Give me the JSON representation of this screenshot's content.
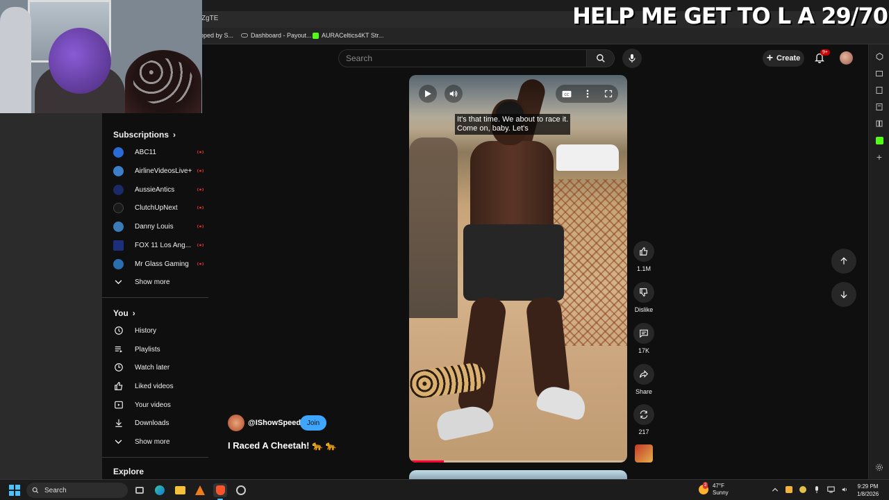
{
  "browser": {
    "url_fragment": "ZgTE",
    "bookmarks": [
      {
        "label": "pped by S...",
        "icon": "bookmark-icon"
      },
      {
        "label": "Dashboard - Payout...",
        "icon": "link-icon"
      },
      {
        "label": "AURACeltics4KT Str...",
        "icon": "kick-icon"
      }
    ]
  },
  "overlay": {
    "banner": "HELP ME GET TO L A 29/70"
  },
  "header": {
    "search_placeholder": "Search",
    "create_label": "Create",
    "notif_count": "9+"
  },
  "guide": {
    "subscriptions_title": "Subscriptions",
    "subscriptions": [
      {
        "label": "ABC11",
        "color": "#2b6bd6"
      },
      {
        "label": "AirlineVideosLive+",
        "color": "#3d7ec9"
      },
      {
        "label": "AussieAntics",
        "color": "#1b2a66"
      },
      {
        "label": "ClutchUpNext",
        "color": "#1a1a1a"
      },
      {
        "label": "Danny Louis",
        "color": "#3a7bb8"
      },
      {
        "label": "FOX 11 Los Ang...",
        "color": "#1c2f7a"
      },
      {
        "label": "Mr Glass Gaming",
        "color": "#2a6db0"
      }
    ],
    "show_more_1": "Show more",
    "you_title": "You",
    "you_items": [
      {
        "label": "History",
        "icon": "history-icon"
      },
      {
        "label": "Playlists",
        "icon": "playlists-icon"
      },
      {
        "label": "Watch later",
        "icon": "watch-later-icon"
      },
      {
        "label": "Liked videos",
        "icon": "thumbs-up-icon"
      },
      {
        "label": "Your videos",
        "icon": "your-videos-icon"
      },
      {
        "label": "Downloads",
        "icon": "download-icon"
      }
    ],
    "show_more_2": "Show more",
    "explore_title": "Explore"
  },
  "short": {
    "caption_line1": "It's that time. We about to race it.",
    "caption_line2": "Come on, baby. Let's",
    "progress": 0.16,
    "channel": "@IShowSpeed",
    "join_label": "Join",
    "title": "I Raced A Cheetah! 🐆 🐆"
  },
  "actions": {
    "likes": "1.1M",
    "dislike": "Dislike",
    "comments": "17K",
    "share": "Share",
    "remix": "217"
  },
  "taskbar": {
    "search_label": "Search",
    "weather_badge": "2",
    "temp": "47°F",
    "condition": "Sunny",
    "time": "9:29 PM",
    "date": "1/8/2026"
  }
}
